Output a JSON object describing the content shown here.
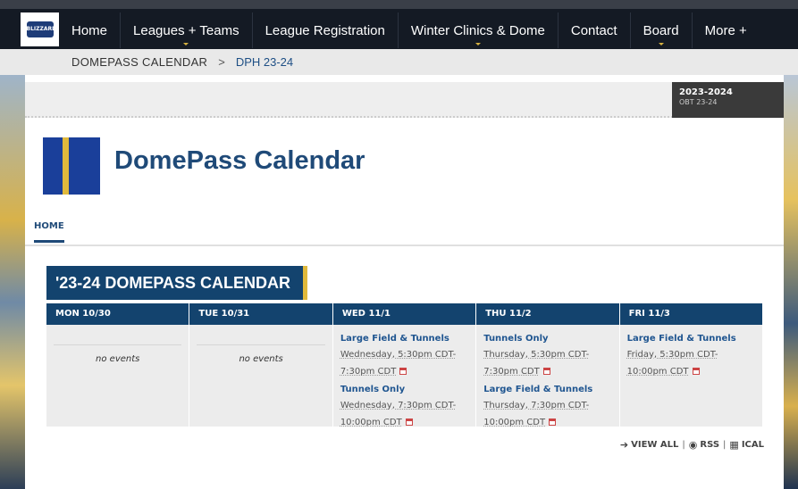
{
  "nav": {
    "logo_text": "BLIZZARD",
    "items": [
      {
        "label": "Home",
        "caret": false
      },
      {
        "label": "Leagues + Teams",
        "caret": true
      },
      {
        "label": "League Registration",
        "caret": false
      },
      {
        "label": "Winter Clinics & Dome",
        "caret": true
      },
      {
        "label": "Contact",
        "caret": false
      },
      {
        "label": "Board",
        "caret": true
      },
      {
        "label": "More +",
        "caret": false
      }
    ]
  },
  "breadcrumb": {
    "crumb1": "DOMEPASS CALENDAR",
    "separator": ">",
    "crumb2": "DPH 23-24"
  },
  "season": {
    "year": "2023-2024",
    "sub": "OBT 23-24"
  },
  "page": {
    "title": "DomePass Calendar",
    "tab_home": "HOME"
  },
  "calendar": {
    "heading": "'23-24 DOMEPASS CALENDAR",
    "days": [
      {
        "label": "MON 10/30",
        "no_events": "no events"
      },
      {
        "label": "TUE 10/31",
        "no_events": "no events"
      },
      {
        "label": "WED 11/1",
        "events": [
          {
            "title": "Large Field & Tunnels",
            "time": "Wednesday, 5:30pm CDT-7:30pm CDT"
          },
          {
            "title": "Tunnels Only",
            "time": "Wednesday, 7:30pm CDT-10:00pm CDT"
          }
        ]
      },
      {
        "label": "THU 11/2",
        "events": [
          {
            "title": "Tunnels Only",
            "time": "Thursday, 5:30pm CDT-7:30pm CDT"
          },
          {
            "title": "Large Field & Tunnels",
            "time": "Thursday, 7:30pm CDT-10:00pm CDT"
          }
        ]
      },
      {
        "label": "FRI 11/3",
        "events": [
          {
            "title": "Large Field & Tunnels",
            "time": "Friday, 5:30pm CDT-10:00pm CDT"
          }
        ]
      }
    ]
  },
  "footer": {
    "view_all": "VIEW ALL",
    "rss": "RSS",
    "ical": "ICAL",
    "sep": "|"
  },
  "colors": {
    "navy": "#13436e",
    "gold": "#e0b93c",
    "link": "#1f5590"
  }
}
